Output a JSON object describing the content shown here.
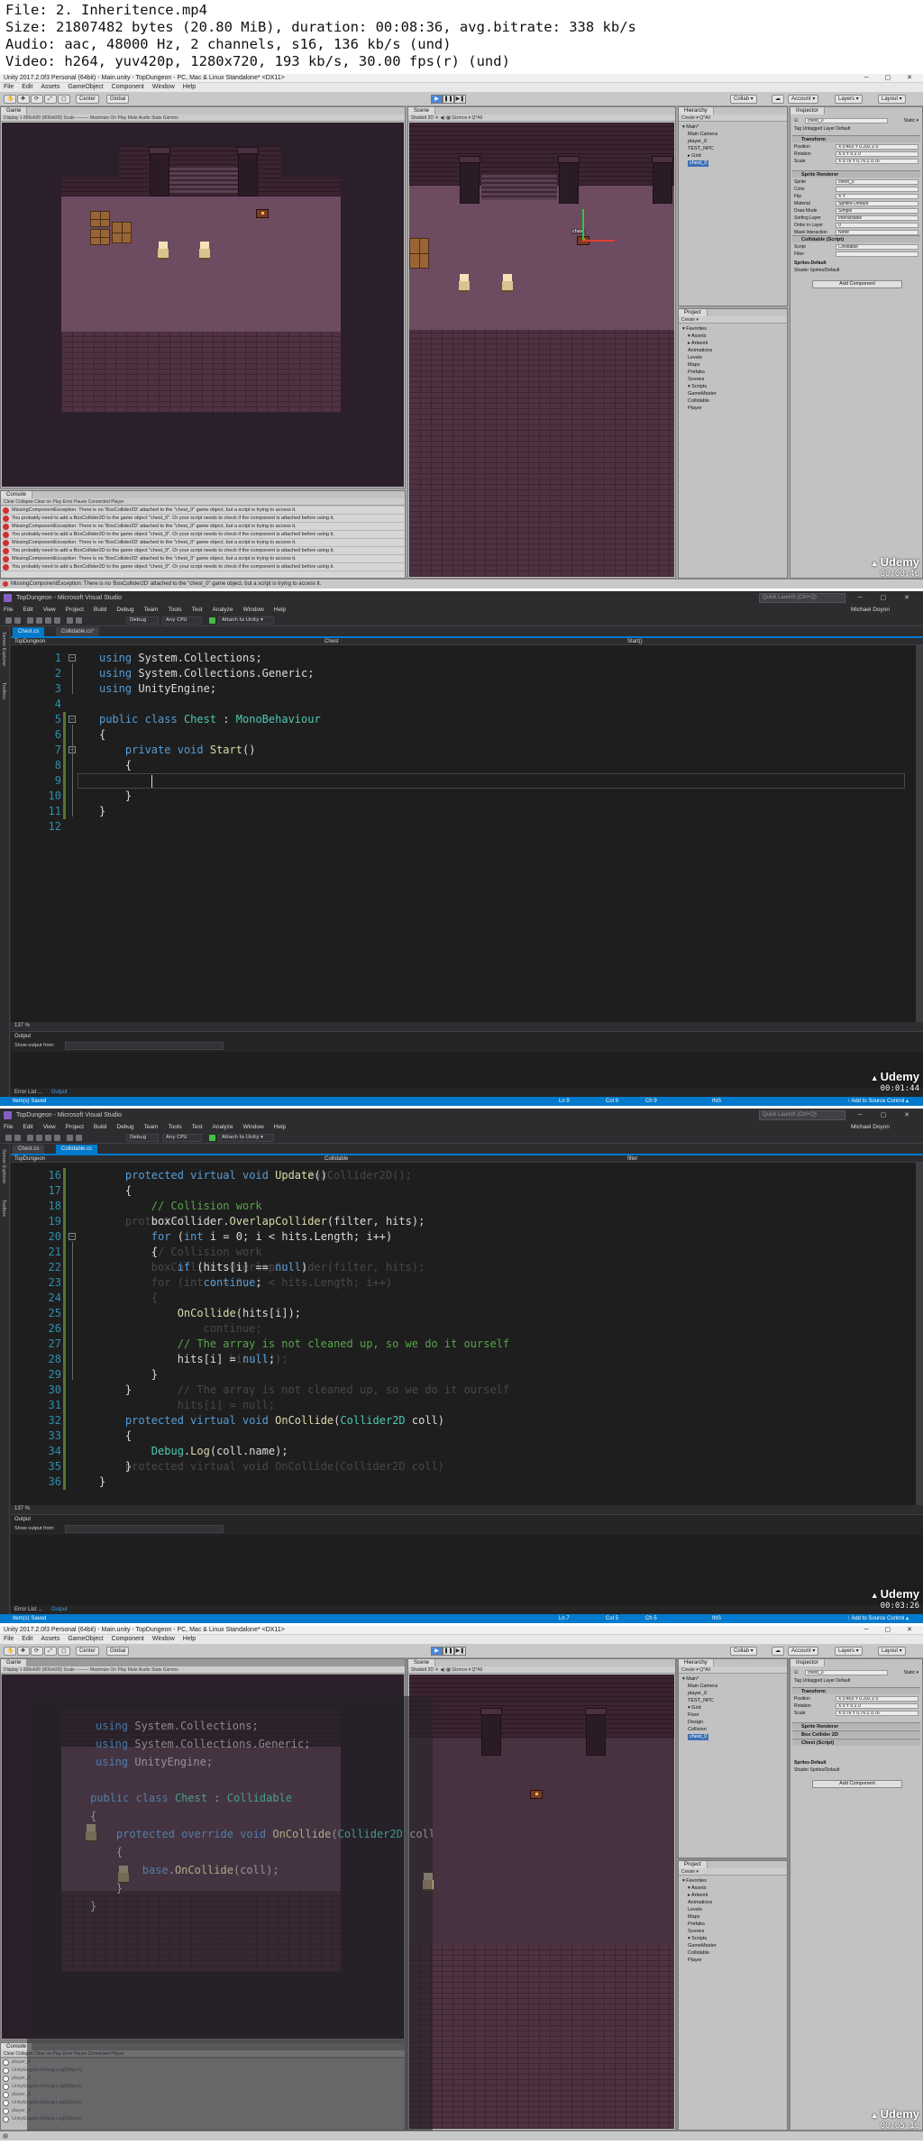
{
  "header": {
    "file": "File: 2. Inheritence.mp4",
    "size": "Size: 21807482 bytes (20.80 MiB), duration: 00:08:36, avg.bitrate: 338 kb/s",
    "audio": "Audio: aac, 48000 Hz, 2 channels, s16, 136 kb/s (und)",
    "video": "Video: h264, yuv420p, 1280x720, 193 kb/s, 30.00 fps(r) (und)"
  },
  "unity": {
    "title": "Unity 2017.2.0f3 Personal (64bit) - Main.unity - TopDungeon - PC, Mac & Linux Standalone* <DX11>",
    "window_controls": "─ ▢ ✕",
    "menu": [
      "File",
      "Edit",
      "Assets",
      "GameObject",
      "Component",
      "Window",
      "Help"
    ],
    "toolbar": {
      "center": "Center",
      "global": "Global",
      "collab": "Collab ▾",
      "account": "Account ▾",
      "layers": "Layers ▾",
      "layout": "Layout ▾",
      "play": "▶",
      "pause": "❚❚",
      "step": "▶❚"
    },
    "game_tab": "Game",
    "game_bar": "Display 1   800x600 (800x600)   Scale ────   Maximize On Play  Mute Audio  Stats  Gizmos",
    "scene_tab": "Scene",
    "scene_bar": "Shaded   2D   ☀   ◀)   ▦   Gizmos ▾   Q*All",
    "console_tab": "Console",
    "console_bar": "Clear   Collapse   Clear on Play   Error Pause   Connected Player",
    "console_rows": [
      "MissingComponentException: There is no 'BoxCollider2D' attached to the \"chest_0\" game object, but a script is trying to access it.",
      "You probably need to add a BoxCollider2D to the game object \"chest_0\". Or your script needs to check if the component is attached before using it.",
      "MissingComponentException: There is no 'BoxCollider2D' attached to the \"chest_0\" game object, but a script is trying to access it.",
      "You probably need to add a BoxCollider2D to the game object \"chest_0\". Or your script needs to check if the component is attached before using it.",
      "MissingComponentException: There is no 'BoxCollider2D' attached to the \"chest_0\" game object, but a script is trying to access it.",
      "You probably need to add a BoxCollider2D to the game object \"chest_0\". Or your script needs to check if the component is attached before using it.",
      "MissingComponentException: There is no 'BoxCollider2D' attached to the \"chest_0\" game object, but a script is trying to access it.",
      "You probably need to add a BoxCollider2D to the game object \"chest_0\". Or your script needs to check if the component is attached before using it."
    ],
    "hierarchy_tab": "Hierarchy",
    "hierarchy_create": "Create ▾   Q*All",
    "hierarchy": [
      "▾ Main*",
      "Main Camera",
      "player_0",
      "TEST_NPC",
      "▸ Grid",
      "chest_0"
    ],
    "project_tab": "Project",
    "project_create": "Create ▾",
    "project_tree": [
      "▾ Favorites",
      "▾ Assets",
      "▸ Artwork",
      "Animations",
      "Levels",
      "Maps",
      "Prefabs",
      "Scenes",
      "▾ Scripts",
      "GameMaster",
      "Collidable",
      "Player"
    ],
    "inspector_tab": "Inspector",
    "inspector_name": "chest_0",
    "inspector_static": "Static ▾",
    "inspector_tag": "Tag  Untagged   Layer  Default",
    "transform_head": "Transform",
    "transform_rows": [
      {
        "label": "Position",
        "value": "X 0.403   Y 0.292   Z 0"
      },
      {
        "label": "Rotation",
        "value": "X 0   Y 0   Z 0"
      },
      {
        "label": "Scale",
        "value": "X 0.76   Y 0.76   Z 0.76"
      }
    ],
    "sprite_head": "Sprite Renderer",
    "sprite_rows": [
      {
        "label": "Sprite",
        "value": "chest_0"
      },
      {
        "label": "Color",
        "value": ""
      },
      {
        "label": "Flip",
        "value": "X   Y"
      },
      {
        "label": "Material",
        "value": "Sprites-Default"
      },
      {
        "label": "Draw Mode",
        "value": "Simple"
      },
      {
        "label": "Sorting Layer",
        "value": "Interactable"
      },
      {
        "label": "Order in Layer",
        "value": "0"
      },
      {
        "label": "Mask Interaction",
        "value": "None"
      }
    ],
    "collidable_head": "Collidable (Script)",
    "collidable_rows": [
      {
        "label": "Script",
        "value": "Collidable"
      },
      {
        "label": "Filter",
        "value": ""
      }
    ],
    "material_name": "Sprites-Default",
    "material_shader": "Shader  Sprites/Default",
    "add_component": "Add Component",
    "status_error": "MissingComponentException: There is no 'BoxCollider2D' attached to the \"chest_0\" game object, but a script is trying to access it.",
    "scene_label": "chest"
  },
  "vs": {
    "title": "TopDungeon - Microsoft Visual Studio",
    "quick_launch": "Quick Launch (Ctrl+Q)",
    "menu": [
      "File",
      "Edit",
      "View",
      "Project",
      "Build",
      "Debug",
      "Team",
      "Tools",
      "Test",
      "Analyze",
      "Window",
      "Help"
    ],
    "user": "Michael Doyon",
    "toolbar": {
      "config": "Debug",
      "platform": "Any CPU",
      "attach": "Attach to Unity ▾"
    },
    "side_tabs": [
      "Server Explorer",
      "Toolbox"
    ],
    "zoom": "137 %",
    "output_title": "Output",
    "output_from": "Show output from:",
    "output_tabs": [
      "Error List ...",
      "Output"
    ],
    "status": {
      "left": "Item(s) Saved",
      "right_add": "↑ Add to Source Control ▴"
    }
  },
  "frame2": {
    "tabs": [
      "Chest.cs",
      "Collidable.cs*"
    ],
    "nav": [
      "TopDungeon",
      "Chest",
      "Start()"
    ],
    "status": {
      "ln": "Ln 9",
      "col": "Col 9",
      "ch": "Ch 9",
      "ins": "INS"
    },
    "code": [
      {
        "n": "1",
        "t": "using System.Collections;"
      },
      {
        "n": "2",
        "t": "using System.Collections.Generic;"
      },
      {
        "n": "3",
        "t": "using UnityEngine;"
      },
      {
        "n": "4",
        "t": ""
      },
      {
        "n": "5",
        "t": "public class Chest : MonoBehaviour"
      },
      {
        "n": "6",
        "t": "{"
      },
      {
        "n": "7",
        "t": "    private void Start()"
      },
      {
        "n": "8",
        "t": "    {"
      },
      {
        "n": "9",
        "t": "        "
      },
      {
        "n": "10",
        "t": "    }"
      },
      {
        "n": "11",
        "t": "}"
      },
      {
        "n": "12",
        "t": ""
      }
    ],
    "time": "00:01:44"
  },
  "frame3": {
    "tabs": [
      "Chest.cs",
      "Collidable.cs"
    ],
    "nav": [
      "TopDungeon",
      "Collidable",
      "filter"
    ],
    "status": {
      "ln": "Ln 7",
      "col": "Col 5",
      "ch": "Ch 5",
      "ins": "INS"
    },
    "code": [
      {
        "n": "16",
        "t": "    protected virtual void Update()",
        "g": "                                BoxCollider2D();"
      },
      {
        "n": "17",
        "t": "    {",
        "g": ""
      },
      {
        "n": "18",
        "t": "        // Collision work",
        "g": ""
      },
      {
        "n": "19",
        "t": "        boxCollider.OverlapCollider(filter, hits);",
        "g": "    protected   "
      },
      {
        "n": "20",
        "t": "        for (int i = 0; i < hits.Length; i++)",
        "g": ""
      },
      {
        "n": "21",
        "t": "        {",
        "g": "        // Collision work"
      },
      {
        "n": "22",
        "t": "            if (hits[i] == null)",
        "g": "        boxCollider.OverlapCollider(filter, hits);"
      },
      {
        "n": "23",
        "t": "                continue;",
        "g": "        for (int i = 0; i < hits.Length; i++)"
      },
      {
        "n": "24",
        "t": "",
        "g": "        {"
      },
      {
        "n": "25",
        "t": "            OnCollide(hits[i]);",
        "g": ""
      },
      {
        "n": "26",
        "t": "",
        "g": "                continue;"
      },
      {
        "n": "27",
        "t": "            // The array is not cleaned up, so we do it ourself",
        "g": ""
      },
      {
        "n": "28",
        "t": "            hits[i] = null;",
        "g": "                    hits[i]);"
      },
      {
        "n": "29",
        "t": "        }",
        "g": ""
      },
      {
        "n": "30",
        "t": "    }",
        "g": "            // The array is not cleaned up, so we do it ourself"
      },
      {
        "n": "31",
        "t": "",
        "g": "            hits[i] = null;"
      },
      {
        "n": "32",
        "t": "    protected virtual void OnCollide(Collider2D coll)",
        "g": ""
      },
      {
        "n": "33",
        "t": "    {",
        "g": ""
      },
      {
        "n": "34",
        "t": "        Debug.Log(coll.name);",
        "g": ""
      },
      {
        "n": "35",
        "t": "    }",
        "g": "    protected virtual void OnCollide(Collider2D coll)"
      },
      {
        "n": "36",
        "t": "}",
        "g": ""
      }
    ],
    "time": "00:03:26"
  },
  "frame4": {
    "hierarchy": [
      "▾ Main*",
      "Main Camera",
      "player_0",
      "TEST_NPC",
      "▾ Grid",
      "Floor",
      "Design",
      "Collision",
      "chest_0"
    ],
    "inspector_heads": [
      "Transform",
      "Sprite Renderer",
      "Box Collider 2D",
      "Chest (Script)"
    ],
    "overlay_code": [
      "using System.Collections;",
      "using System.Collections.Generic;",
      "using UnityEngine;",
      "",
      "public class Chest : Collidable",
      "{",
      "    protected override void OnCollide(Collider2D coll)",
      "    {",
      "        base.OnCollide(coll);",
      "    }",
      "}"
    ],
    "console_rows": [
      "player_0",
      "UnityEngine.Debug:Log(Object)",
      "player_0",
      "UnityEngine.Debug:Log(Object)",
      "player_0",
      "UnityEngine.Debug:Log(Object)",
      "player_0",
      "UnityEngine.Debug:Log(Object)"
    ],
    "time": "00:05:10"
  },
  "frame1_time": "00:00:46",
  "watermark_brand": "Udemy"
}
